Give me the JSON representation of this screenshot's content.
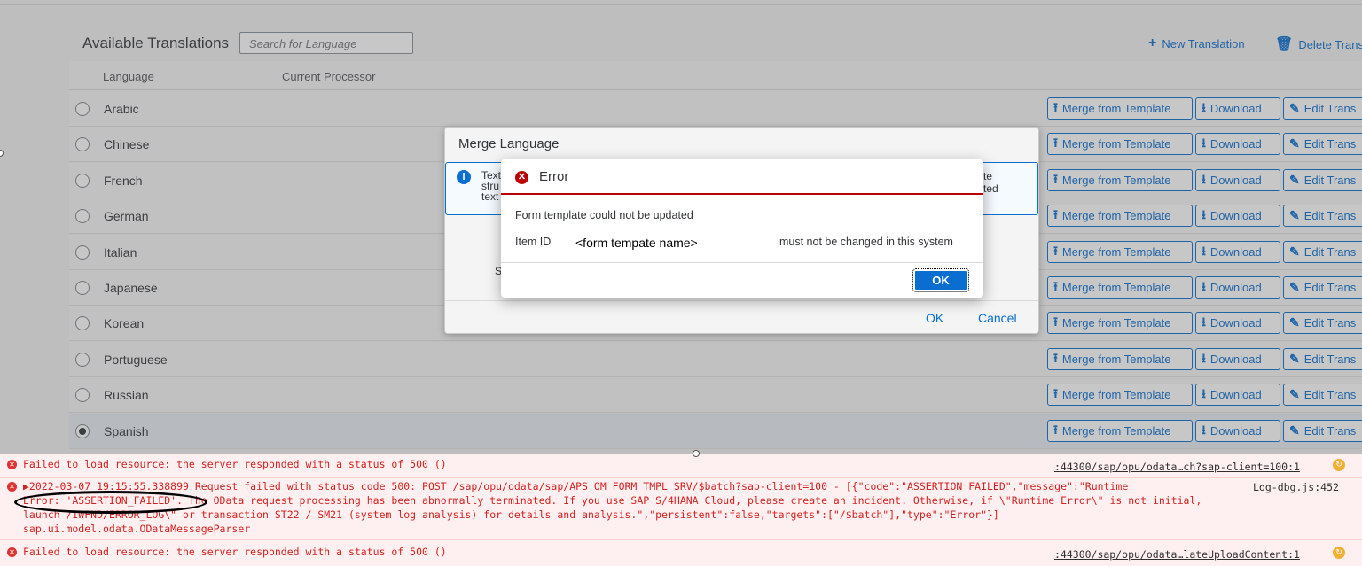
{
  "toolbar": {
    "title": "Available Translations",
    "search_placeholder": "Search for Language",
    "new_label": "New Translation",
    "delete_label": "Delete Trans",
    "new_icon": "plus-icon",
    "delete_icon": "trash-icon"
  },
  "table": {
    "columns": [
      "Language",
      "Current Processor"
    ],
    "rows": [
      {
        "language": "Arabic",
        "selected": false
      },
      {
        "language": "Chinese",
        "selected": false
      },
      {
        "language": "French",
        "selected": false
      },
      {
        "language": "German",
        "selected": false
      },
      {
        "language": "Italian",
        "selected": false
      },
      {
        "language": "Japanese",
        "selected": false
      },
      {
        "language": "Korean",
        "selected": false
      },
      {
        "language": "Portuguese",
        "selected": false
      },
      {
        "language": "Russian",
        "selected": false
      },
      {
        "language": "Spanish",
        "selected": true
      }
    ],
    "merge_label": "Merge from Template",
    "download_label": "Download",
    "edit_label": "Edit Trans"
  },
  "merge_dialog": {
    "title": "Merge Language",
    "info_left": "Text\nstru\ntext",
    "info_right": "te\nted",
    "s_label": "S",
    "ok": "OK",
    "cancel": "Cancel"
  },
  "error_dialog": {
    "title": "Error",
    "message": "Form template could not be updated",
    "item_label": "Item ID",
    "item_name": "<form tempate name>",
    "suffix": "must not be changed in this system",
    "ok": "OK"
  },
  "console": {
    "line1": "Failed to load resource: the server responded with a status of 500 ()",
    "line1_src": ":44300/sap/opu/odata…ch?sap-client=100:1",
    "line2a": "▶2022-03-07 19:15:55.338899 Request failed with status code 500: POST /sap/opu/odata/sap/APS_OM_FORM_TMPL_SRV/$batch?sap-client=100 - [{\"code\":\"ASSERTION_FAILED\",\"message\":\"Runtime",
    "line2b": "Error: 'ASSERTION_FAILED'. The OData request processing has been abnormally terminated. If you use SAP S/4HANA Cloud, please create an incident. Otherwise, if \\\"Runtime Error\\\" is not initial,",
    "line2c": "launch /IWFND/ERROR_LOG\\\" or transaction ST22 / SM21 (system log analysis) for details and analysis.\",\"persistent\":false,\"targets\":[\"/$batch\"],\"type\":\"Error\"}]",
    "line2d": "sap.ui.model.odata.ODataMessageParser",
    "line2_src": "Log-dbg.js:452",
    "line3": "Failed to load resource: the server responded with a status of 500 ()",
    "line3_src": ":44300/sap/opu/odata…lateUploadContent:1"
  }
}
